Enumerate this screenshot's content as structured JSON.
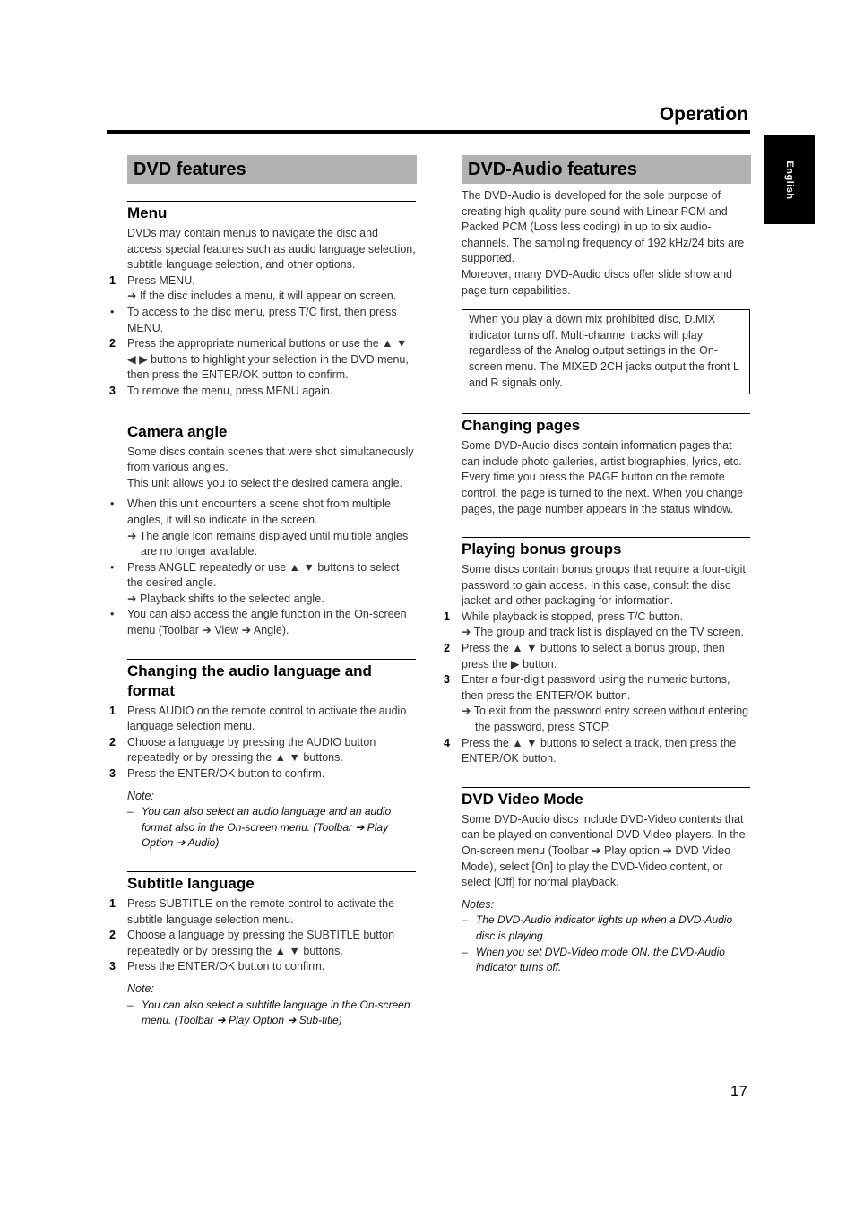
{
  "header": {
    "title": "Operation",
    "language_tab": "English"
  },
  "left": {
    "banner": "DVD features",
    "menu": {
      "title": "Menu",
      "intro": "DVDs may contain menus to navigate the disc and access special features such as audio language selection, subtitle language selection, and other options.",
      "steps": [
        {
          "marker": "1",
          "text": "Press MENU."
        },
        {
          "marker": "",
          "text": "➜ If the disc includes a menu, it will appear on screen."
        },
        {
          "marker": "•",
          "text": "To access to the disc menu, press T/C first, then press MENU."
        },
        {
          "marker": "2",
          "text": "Press the appropriate numerical buttons or use the ▲ ▼ ◀ ▶ buttons to highlight your selection in the DVD menu, then press the ENTER/OK button to confirm."
        },
        {
          "marker": "3",
          "text": "To remove the menu, press MENU again."
        }
      ]
    },
    "camera": {
      "title": "Camera angle",
      "intro1": "Some discs contain scenes that were shot simultaneously from various angles.",
      "intro2": "This unit allows you to select the desired camera angle.",
      "b1": "When this unit encounters a scene shot from multiple angles, it will so indicate in the screen.",
      "b1_sub": "➜ The angle icon remains displayed until multiple angles are no longer available.",
      "b2": "Press ANGLE repeatedly or use ▲ ▼ buttons to select the desired angle.",
      "b2_sub": "➜ Playback shifts to the selected angle.",
      "b3": "You can also access the angle function in the On-screen menu (Toolbar ➔ View ➔ Angle)."
    },
    "audio": {
      "title": "Changing the audio language and format",
      "s1": "Press AUDIO on the remote control to activate the audio language selection menu.",
      "s2": "Choose a language by pressing the AUDIO button repeatedly or by pressing the ▲ ▼ buttons.",
      "s3": "Press the ENTER/OK button to confirm.",
      "note_label": "Note:",
      "note": "You can also select an audio language and an audio format also in the On-screen menu. (Toolbar ➔ Play Option ➔ Audio)"
    },
    "subtitle": {
      "title": "Subtitle language",
      "s1": "Press SUBTITLE on the remote control to activate the subtitle language selection menu.",
      "s2": "Choose a language by pressing the SUBTITLE button repeatedly or by pressing the ▲ ▼ buttons.",
      "s3": "Press the ENTER/OK button to confirm.",
      "note_label": "Note:",
      "note": "You can also select a subtitle language in the On-screen menu. (Toolbar ➔ Play Option ➔ Sub-title)"
    }
  },
  "right": {
    "banner": "DVD-Audio features",
    "intro1": "The DVD-Audio is developed for the sole purpose of creating high quality pure sound with Linear PCM and Packed PCM (Loss less coding) in up to six audio-channels. The sampling frequency of 192 kHz/24 bits are supported.",
    "intro2": "Moreover, many DVD-Audio discs offer slide show and page turn capabilities.",
    "box": "When you play a down mix prohibited disc, D.MIX indicator turns off. Multi-channel tracks will play regardless of the Analog output settings in the On-screen menu. The MIXED 2CH jacks output the front L and R signals only.",
    "pages": {
      "title": "Changing pages",
      "text": "Some DVD-Audio discs contain information pages that can include photo galleries, artist biographies, lyrics, etc. Every time you press the PAGE button on the remote control, the page is turned to the next. When you change pages, the page number appears in the status window."
    },
    "bonus": {
      "title": "Playing bonus groups",
      "intro": "Some discs contain bonus groups that require a four-digit password to gain access. In this case, consult the disc jacket and other packaging for information.",
      "s1": "While playback is stopped, press T/C button.",
      "s1_sub": "➜ The group and track list is displayed on the TV screen.",
      "s2": "Press the ▲ ▼ buttons to select a bonus group, then press the ▶ button.",
      "s3": "Enter a four-digit password using the numeric buttons, then press the ENTER/OK button.",
      "s3_sub": "➜ To exit from the password entry screen without entering the password, press STOP.",
      "s4": "Press the ▲ ▼ buttons to select a track, then press the ENTER/OK button."
    },
    "video": {
      "title": "DVD Video Mode",
      "text": "Some DVD-Audio discs include DVD-Video contents that can be played on conventional DVD-Video players. In the On-screen menu (Toolbar ➔ Play option ➔ DVD Video Mode), select [On] to play the DVD-Video content, or select [Off] for normal playback.",
      "notes_label": "Notes:",
      "n1": "The DVD-Audio indicator lights up when a DVD-Audio disc is playing.",
      "n2": "When you set DVD-Video mode ON, the DVD-Audio indicator turns off."
    }
  },
  "page_number": "17"
}
